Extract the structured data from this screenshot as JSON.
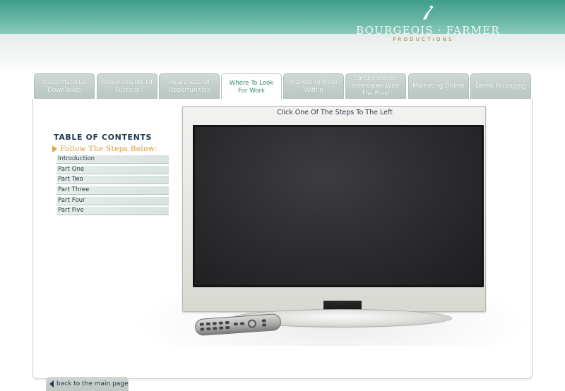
{
  "brand": {
    "name": "BOURGEOIS · FARMER",
    "subtitle": "PRODUCTIONS",
    "accent_color": "#3f9d8b"
  },
  "tabs": [
    {
      "label": "Class Material Downloads",
      "active": false
    },
    {
      "label": "Requirements Of Success",
      "active": false
    },
    {
      "label": "Awareness Of Opportunities",
      "active": false
    },
    {
      "label": "Where To Look For Work",
      "active": true
    },
    {
      "label": "Marketing From Within",
      "active": false
    },
    {
      "label": "Candid Voices: Interviews With The Pros!",
      "active": false
    },
    {
      "label": "Marketing Online",
      "active": false
    },
    {
      "label": "Demo Packaging",
      "active": false
    }
  ],
  "toc": {
    "title": "TABLE OF CONTENTS",
    "subtitle": "Follow The Steps Below:",
    "items": [
      "Introduction",
      "Part One",
      "Part Two",
      "Part Three",
      "Part Four",
      "Part Five"
    ]
  },
  "tv": {
    "caption": "Click One Of The Steps To The Left"
  },
  "back_link": {
    "label": "back to the main page"
  }
}
